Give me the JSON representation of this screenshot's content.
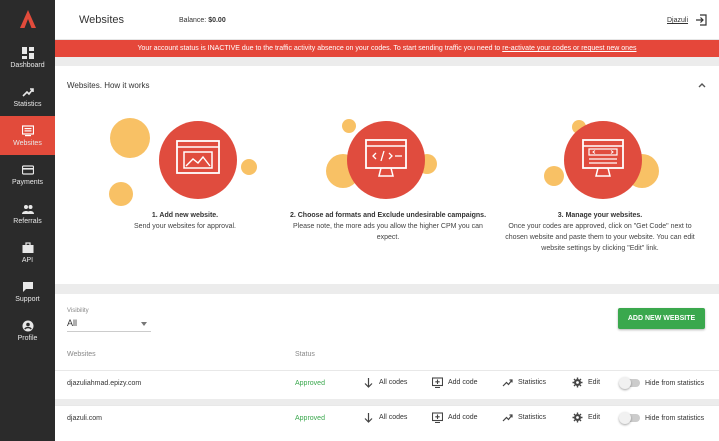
{
  "app": {
    "logo_letter": "A"
  },
  "sidebar": {
    "items": [
      {
        "label": "Dashboard",
        "icon": "dashboard-icon",
        "active": false
      },
      {
        "label": "Statistics",
        "icon": "trending-up-icon",
        "active": false
      },
      {
        "label": "Websites",
        "icon": "websites-icon",
        "active": true
      },
      {
        "label": "Payments",
        "icon": "card-icon",
        "active": false
      },
      {
        "label": "Referrals",
        "icon": "people-icon",
        "active": false
      },
      {
        "label": "API",
        "icon": "briefcase-icon",
        "active": false
      },
      {
        "label": "Support",
        "icon": "chat-icon",
        "active": false
      },
      {
        "label": "Profile",
        "icon": "account-icon",
        "active": false
      }
    ]
  },
  "header": {
    "title": "Websites",
    "balance_label": "Balance:",
    "balance_value": "$0.00",
    "user": "Djazuli"
  },
  "alert": {
    "text": "Your account status is INACTIVE due to the traffic activity absence on your codes. To start sending traffic you need to ",
    "link_text": "re-activate your codes or request new ones",
    "color": "#e5473a"
  },
  "how_it_works": {
    "title": "Websites. How it works",
    "steps": [
      {
        "head": "1. Add new website.",
        "text": "Send your websites for approval."
      },
      {
        "head": "2. Choose ad formats and Exclude undesirable campaigns.",
        "text": "Please note, the more ads you allow the higher CPM you can expect."
      },
      {
        "head": "3. Manage your websites.",
        "text": "Once your codes are approved, click on \"Get Code\" next to chosen website and paste them to your website. You can edit website settings by clicking \"Edit\" link."
      }
    ]
  },
  "websites": {
    "visibility_label": "Visibility",
    "visibility_value": "All",
    "add_button": "ADD NEW WEBSITE",
    "col_websites": "Websites",
    "col_status": "Status",
    "rows": [
      {
        "site": "djazuliahmad.epizy.com",
        "status": "Approved"
      },
      {
        "site": "djazuli.com",
        "status": "Approved"
      }
    ],
    "actions": {
      "all_codes": "All codes",
      "add_code": "Add code",
      "statistics": "Statistics",
      "edit": "Edit",
      "hide": "Hide from statistics"
    }
  },
  "colors": {
    "accent": "#e24b3b",
    "success": "#3aa84d",
    "sidebar_bg": "#2b2b2b"
  }
}
